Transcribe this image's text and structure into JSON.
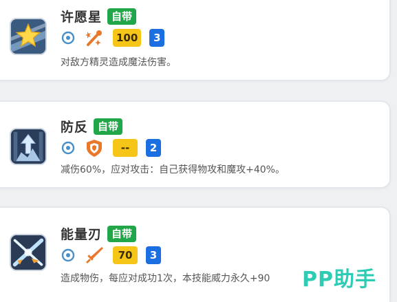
{
  "skills": [
    {
      "name": "许愿星",
      "tag": "自带",
      "target_icon": "target-circle-icon",
      "type_icon": "magic-wand-icon",
      "power": "100",
      "pp": "3",
      "description": "对敌方精灵造成魔法伤害。"
    },
    {
      "name": "防反",
      "tag": "自带",
      "target_icon": "target-circle-icon",
      "type_icon": "shield-icon",
      "power": "--",
      "pp": "2",
      "description": "减伤60%，应对攻击：自己获得物攻和魔攻+40%。"
    },
    {
      "name": "能量刃",
      "tag": "自带",
      "target_icon": "target-circle-icon",
      "type_icon": "sword-icon",
      "power": "70",
      "pp": "3",
      "description": "造成物伤，每应对成功1次，本技能威力永久+90"
    }
  ],
  "watermark": "PP助手",
  "colors": {
    "tag_green": "#22a64a",
    "power_yellow": "#f5c518",
    "pp_blue": "#1b6fe0",
    "type_orange": "#e8792a",
    "watermark_teal": "#23c9b2"
  }
}
